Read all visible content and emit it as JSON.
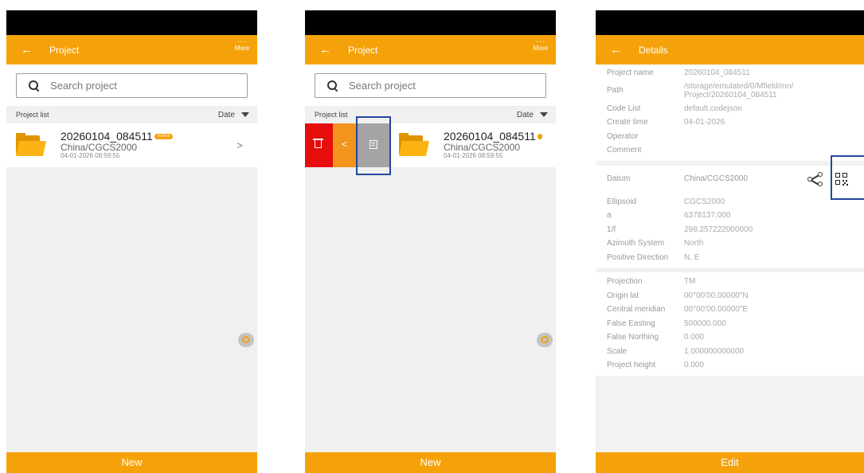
{
  "screen1": {
    "title": "Project",
    "more": "More",
    "search_placeholder": "Search project",
    "list_label": "Project list",
    "sort_label": "Date",
    "project": {
      "name": "20260104_084511",
      "badge": "current",
      "coord": "China/CGCS2000",
      "time": "04-01-2026 08:59:55"
    },
    "new_button": "New"
  },
  "screen2": {
    "title": "Project",
    "more": "More",
    "search_placeholder": "Search project",
    "list_label": "Project list",
    "sort_label": "Date",
    "project": {
      "name": "20260104_084511",
      "coord": "China/CGCS2000",
      "time": "04-01-2026 08:59:55"
    },
    "new_button": "New"
  },
  "screen3": {
    "title": "Details",
    "general": [
      {
        "label": "Project name",
        "value": "20260104_084511"
      },
      {
        "label": "Path",
        "value": "/storage/emulated/0/Mfield/mn/ Project/20260104_084511"
      },
      {
        "label": "Code List",
        "value": "default.codejson"
      },
      {
        "label": "Create time",
        "value": "04-01-2026"
      },
      {
        "label": "Operator",
        "value": ""
      },
      {
        "label": "Comment",
        "value": ""
      }
    ],
    "datum": {
      "label": "Datum",
      "value": "China/CGCS2000"
    },
    "ellipsoid": [
      {
        "label": "Ellipsoid",
        "value": "CGCS2000"
      },
      {
        "label": "a",
        "value": "6378137.000"
      },
      {
        "label": "1/f",
        "value": "298.257222000000"
      },
      {
        "label": "Azimuth System",
        "value": "North"
      },
      {
        "label": "Positive Direction",
        "value": "N, E"
      }
    ],
    "projection": [
      {
        "label": "Projection",
        "value": "TM"
      },
      {
        "label": "Origin lat",
        "value": "00°00'00.00000\"N"
      },
      {
        "label": "Central meridian",
        "value": "00°00'00.00000\"E"
      },
      {
        "label": "False Easting",
        "value": "500000.000"
      },
      {
        "label": "False Northing",
        "value": "0.000"
      },
      {
        "label": "Scale",
        "value": "1.000000000000"
      },
      {
        "label": "Project height",
        "value": "0.000"
      }
    ],
    "edit_button": "Edit"
  },
  "colors": {
    "accent": "#f5a20a",
    "delete": "#e60d0d",
    "share": "#f3941e",
    "details": "#a4a4a4",
    "highlight": "#22479e"
  }
}
